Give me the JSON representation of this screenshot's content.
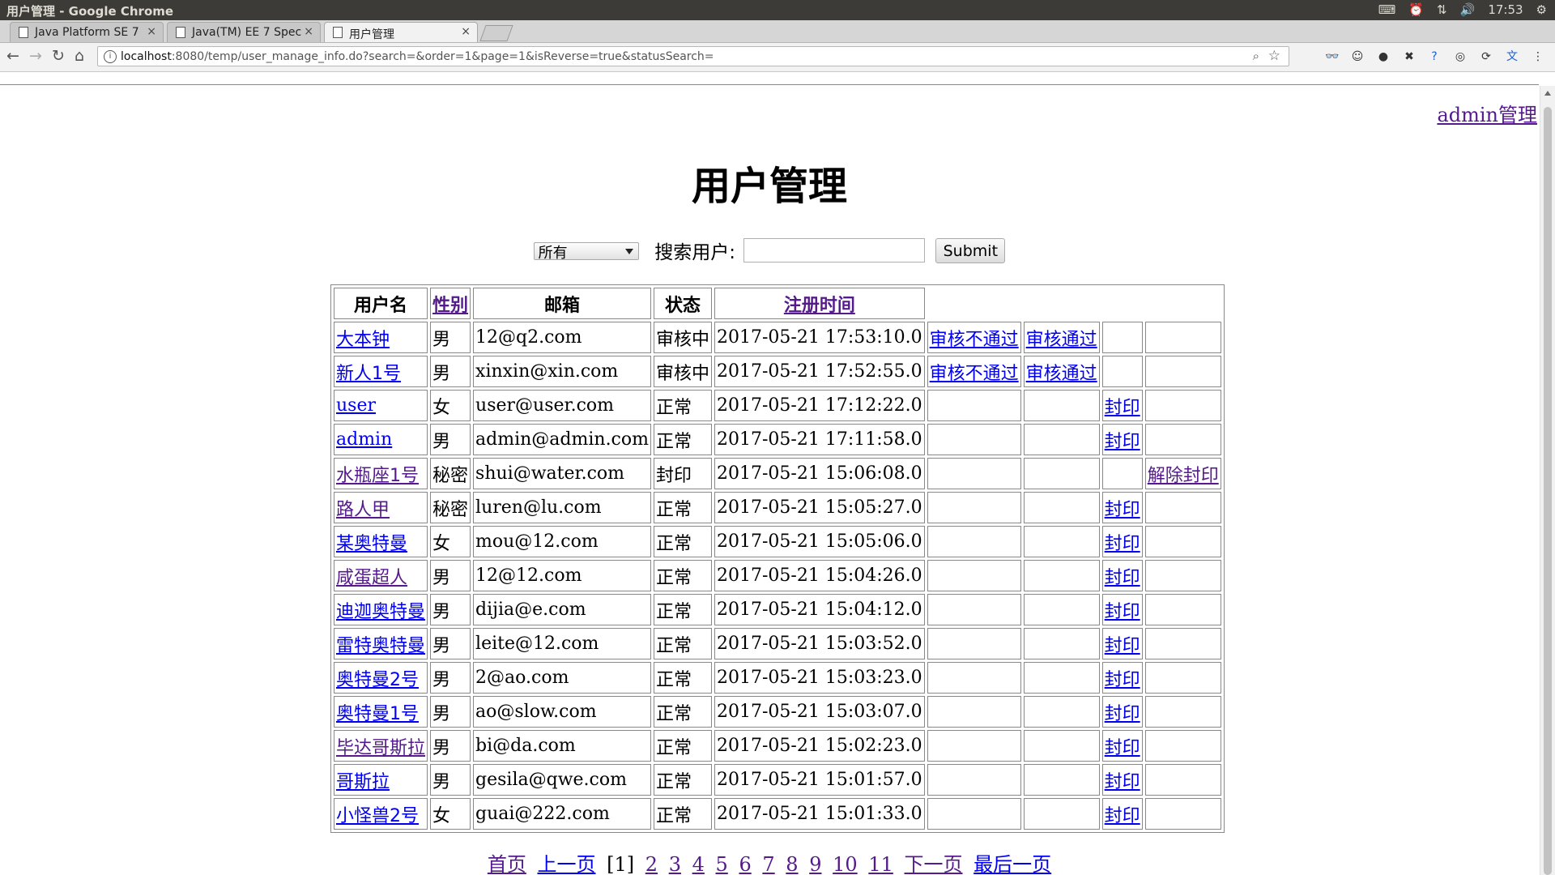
{
  "os": {
    "window_title": "用户管理 - Google Chrome",
    "clock": "17:53"
  },
  "tabs": [
    {
      "label": "Java Platform SE 7",
      "active": false
    },
    {
      "label": "Java(TM) EE 7 Spec",
      "active": false
    },
    {
      "label": "用户管理",
      "active": true
    }
  ],
  "address_bar": {
    "host": "localhost",
    "path": ":8080/temp/user_manage_info.do?search=&order=1&page=1&isReverse=true&statusSearch="
  },
  "page": {
    "admin_link": "admin管理",
    "title": "用户管理",
    "search": {
      "status_selected": "所有",
      "label": "搜索用户:",
      "value": "",
      "submit": "Submit"
    },
    "table": {
      "headers": [
        "用户名",
        "性别",
        "邮箱",
        "状态",
        "注册时间"
      ],
      "rows": [
        {
          "name": "大本钟",
          "gender": "男",
          "email": "12@q2.com",
          "status": "审核中",
          "time": "2017-05-21 17:53:10.0",
          "reject": "审核不通过",
          "approve": "审核通过",
          "ban": "",
          "unban": ""
        },
        {
          "name": "新人1号",
          "gender": "男",
          "email": "xinxin@xin.com",
          "status": "审核中",
          "time": "2017-05-21 17:52:55.0",
          "reject": "审核不通过",
          "approve": "审核通过",
          "ban": "",
          "unban": ""
        },
        {
          "name": "user",
          "gender": "女",
          "email": "user@user.com",
          "status": "正常",
          "time": "2017-05-21 17:12:22.0",
          "reject": "",
          "approve": "",
          "ban": "封印",
          "unban": ""
        },
        {
          "name": "admin",
          "gender": "男",
          "email": "admin@admin.com",
          "status": "正常",
          "time": "2017-05-21 17:11:58.0",
          "reject": "",
          "approve": "",
          "ban": "封印",
          "unban": ""
        },
        {
          "name": "水瓶座1号",
          "gender": "秘密",
          "email": "shui@water.com",
          "status": "封印",
          "time": "2017-05-21 15:06:08.0",
          "reject": "",
          "approve": "",
          "ban": "",
          "unban": "解除封印"
        },
        {
          "name": "路人甲",
          "gender": "秘密",
          "email": "luren@lu.com",
          "status": "正常",
          "time": "2017-05-21 15:05:27.0",
          "reject": "",
          "approve": "",
          "ban": "封印",
          "unban": ""
        },
        {
          "name": "某奥特曼",
          "gender": "女",
          "email": "mou@12.com",
          "status": "正常",
          "time": "2017-05-21 15:05:06.0",
          "reject": "",
          "approve": "",
          "ban": "封印",
          "unban": ""
        },
        {
          "name": "咸蛋超人",
          "gender": "男",
          "email": "12@12.com",
          "status": "正常",
          "time": "2017-05-21 15:04:26.0",
          "reject": "",
          "approve": "",
          "ban": "封印",
          "unban": ""
        },
        {
          "name": "迪迦奥特曼",
          "gender": "男",
          "email": "dijia@e.com",
          "status": "正常",
          "time": "2017-05-21 15:04:12.0",
          "reject": "",
          "approve": "",
          "ban": "封印",
          "unban": ""
        },
        {
          "name": "雷特奥特曼",
          "gender": "男",
          "email": "leite@12.com",
          "status": "正常",
          "time": "2017-05-21 15:03:52.0",
          "reject": "",
          "approve": "",
          "ban": "封印",
          "unban": ""
        },
        {
          "name": "奥特曼2号",
          "gender": "男",
          "email": "2@ao.com",
          "status": "正常",
          "time": "2017-05-21 15:03:23.0",
          "reject": "",
          "approve": "",
          "ban": "封印",
          "unban": ""
        },
        {
          "name": "奥特曼1号",
          "gender": "男",
          "email": "ao@slow.com",
          "status": "正常",
          "time": "2017-05-21 15:03:07.0",
          "reject": "",
          "approve": "",
          "ban": "封印",
          "unban": ""
        },
        {
          "name": "毕达哥斯拉",
          "gender": "男",
          "email": "bi@da.com",
          "status": "正常",
          "time": "2017-05-21 15:02:23.0",
          "reject": "",
          "approve": "",
          "ban": "封印",
          "unban": ""
        },
        {
          "name": "哥斯拉",
          "gender": "男",
          "email": "gesila@qwe.com",
          "status": "正常",
          "time": "2017-05-21 15:01:57.0",
          "reject": "",
          "approve": "",
          "ban": "封印",
          "unban": ""
        },
        {
          "name": "小怪兽2号",
          "gender": "女",
          "email": "guai@222.com",
          "status": "正常",
          "time": "2017-05-21 15:01:33.0",
          "reject": "",
          "approve": "",
          "ban": "封印",
          "unban": ""
        }
      ]
    },
    "pager": {
      "first": "首页",
      "prev": "上一页",
      "current": "[1]",
      "pages": [
        "2",
        "3",
        "4",
        "5",
        "6",
        "7",
        "8",
        "9",
        "10",
        "11"
      ],
      "next": "下一页",
      "last": "最后一页"
    }
  }
}
